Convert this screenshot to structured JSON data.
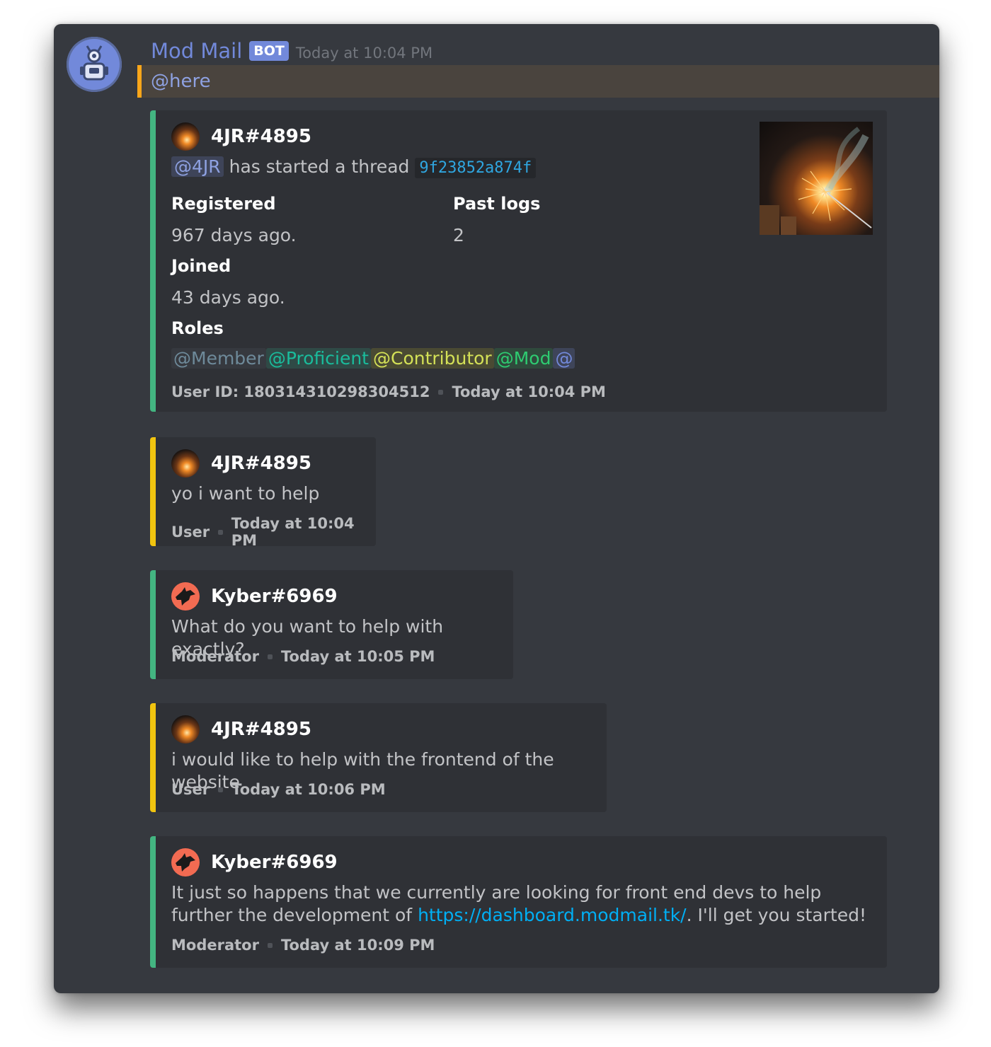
{
  "bot": {
    "name": "Mod Mail",
    "tag": "BOT",
    "time": "Today at 10:04 PM",
    "mention": "@here"
  },
  "thread": {
    "author": "4JR#4895",
    "mention": "@4JR",
    "started_text": "has started a thread",
    "thread_id": "9f23852a874f",
    "fields": {
      "registered_name": "Registered",
      "registered_value": "967 days ago.",
      "past_logs_name": "Past logs",
      "past_logs_value": "2",
      "joined_name": "Joined",
      "joined_value": "43 days ago.",
      "roles_name": "Roles"
    },
    "roles": [
      {
        "label": "@Member",
        "color": "#6e8a9a",
        "bg": "#36393f"
      },
      {
        "label": "@Proficient",
        "color": "#1abc9c",
        "bg": "#2f4a46"
      },
      {
        "label": "@Contributor",
        "color": "#d4e157",
        "bg": "#4a4a33"
      },
      {
        "label": "@Mod",
        "color": "#2ecc71",
        "bg": "#2f4a3c"
      },
      {
        "label": "@",
        "color": "#7289da",
        "bg": "#3e4459"
      }
    ],
    "footer_id": "User ID: 180314310298304512",
    "footer_time": "Today at 10:04 PM"
  },
  "messages": [
    {
      "author": "4JR#4895",
      "text": "yo i want to help",
      "role": "User",
      "time": "Today at 10:04 PM"
    },
    {
      "author": "Kyber#6969",
      "text": "What do you want to help with exactly?",
      "role": "Moderator",
      "time": "Today at 10:05 PM"
    },
    {
      "author": "4JR#4895",
      "text": "i would like to help with the frontend of the website",
      "role": "User",
      "time": "Today at 10:06 PM"
    },
    {
      "author": "Kyber#6969",
      "text_before": "It just so happens that we currently are looking for front end devs to help further the development of ",
      "link": "https://dashboard.modmail.tk/",
      "text_after": ". I'll get you started!",
      "role": "Moderator",
      "time": "Today at 10:09 PM"
    }
  ],
  "colors": {
    "moderator_bar": "#43b581",
    "user_bar": "#f1c40f",
    "mention_bar": "#faa61a",
    "blurple": "#7289da"
  },
  "icons": {
    "bot_avatar": "robot-icon",
    "kyber_avatar": "wolf-icon"
  }
}
